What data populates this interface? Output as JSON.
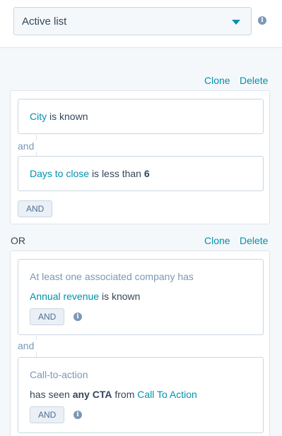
{
  "list_type": {
    "selected": "Active list"
  },
  "group1": {
    "clone_label": "Clone",
    "delete_label": "Delete",
    "filters": [
      {
        "property": "City",
        "operator": "is known"
      },
      {
        "property": "Days to close",
        "operator": "is less than",
        "value": "6"
      }
    ],
    "connector": "and",
    "and_button": "AND"
  },
  "or_label": "OR",
  "group2": {
    "clone_label": "Clone",
    "delete_label": "Delete",
    "filters": [
      {
        "heading": "At least one associated company has",
        "property": "Annual revenue",
        "operator": "is known",
        "and_button": "AND"
      },
      {
        "heading": "Call-to-action",
        "prefix": "has seen",
        "qualifier": "any CTA",
        "middle": "from",
        "target": "Call To Action",
        "and_button": "AND"
      }
    ],
    "connector": "and"
  }
}
